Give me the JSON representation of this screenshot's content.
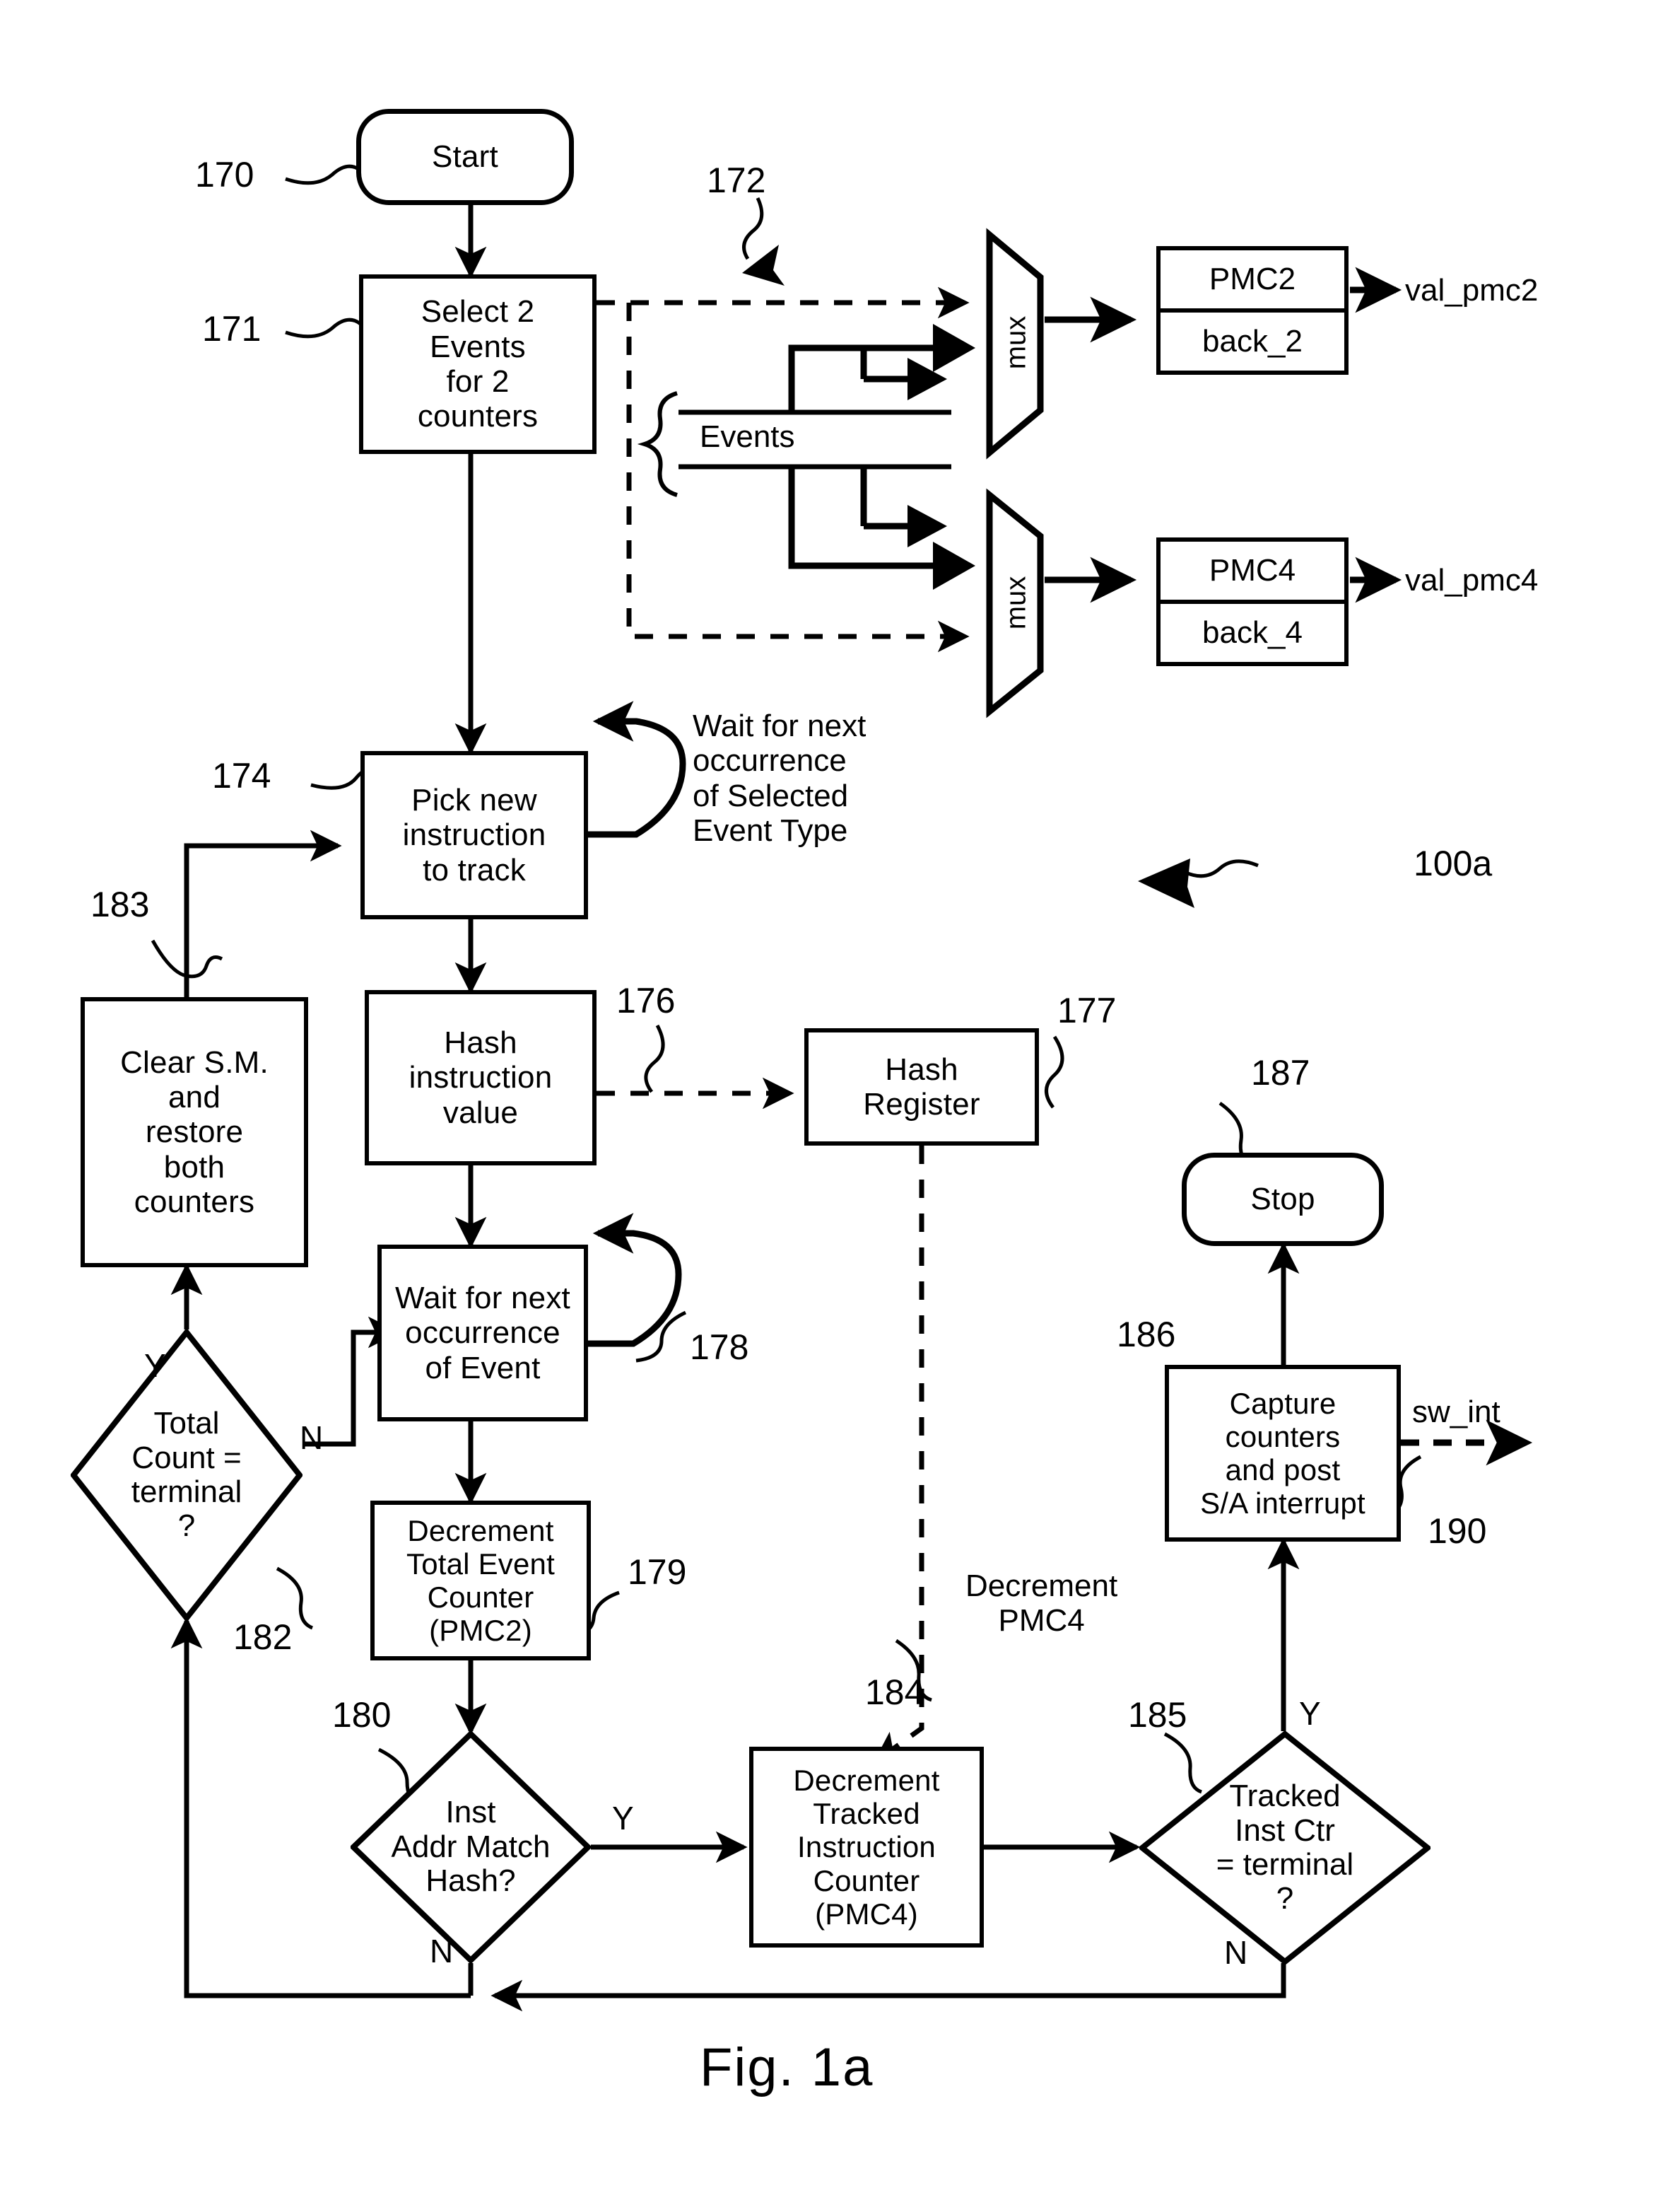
{
  "figure": {
    "caption": "Fig.  1a",
    "overall_ref": "100a"
  },
  "nodes": {
    "start": {
      "label": "Start",
      "ref": "170"
    },
    "select_events": {
      "label": "Select 2\nEvents\nfor 2\ncounters",
      "ref": "171"
    },
    "pick_instruction": {
      "label": "Pick new\ninstruction\nto track",
      "ref": "174"
    },
    "hash_instruction": {
      "label": "Hash\ninstruction\nvalue",
      "ref": "176"
    },
    "hash_register": {
      "label": "Hash\nRegister",
      "ref": "177"
    },
    "wait_event": {
      "label": "Wait for next\noccurrence\nof Event",
      "ref": "178"
    },
    "decrement_total": {
      "label": "Decrement\nTotal Event\nCounter\n(PMC2)",
      "ref": "179"
    },
    "inst_addr_match": {
      "label": "Inst\nAddr Match\nHash?",
      "ref": "180",
      "yes": "Y",
      "no": "N"
    },
    "total_count_terminal": {
      "label": "Total\nCount =\nterminal\n?",
      "ref": "182",
      "yes": "Y",
      "no": "N"
    },
    "clear_sm": {
      "label": "Clear S.M.\nand\nrestore\nboth\ncounters",
      "ref": "183"
    },
    "decrement_tracked": {
      "label": "Decrement\nTracked\nInstruction\nCounter\n(PMC4)",
      "ref": "184"
    },
    "tracked_terminal": {
      "label": "Tracked\nInst Ctr\n= terminal\n?",
      "ref": "185",
      "yes": "Y",
      "no": "N"
    },
    "capture_counters": {
      "label": "Capture\ncounters\nand post\nS/A interrupt",
      "ref": "186"
    },
    "stop": {
      "label": "Stop",
      "ref": "187"
    }
  },
  "hardware": {
    "mux_upper": {
      "label": "mux"
    },
    "mux_lower": {
      "label": "mux"
    },
    "events_bus": {
      "label": "Events",
      "ref": "172"
    },
    "pmc2": {
      "top": "PMC2",
      "bottom": "back_2",
      "output": "val_pmc2"
    },
    "pmc4": {
      "top": "PMC4",
      "bottom": "back_4",
      "output": "val_pmc4"
    }
  },
  "annotations": {
    "wait_selected_event": "Wait for next\noccurrence\nof Selected\nEvent Type",
    "decrement_pmc4": "Decrement\nPMC4",
    "sw_int": "sw_int",
    "sw_int_ref": "190"
  },
  "colors": {
    "stroke": "#000000",
    "background": "#ffffff"
  }
}
